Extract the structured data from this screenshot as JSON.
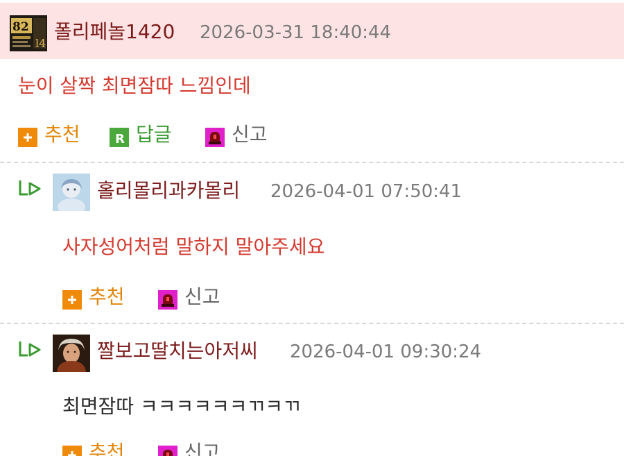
{
  "comments": [
    {
      "nickname": "폴리페놀1420",
      "date": "2026-03-31 18:40:44",
      "text": "눈이 살짝 최면잠따 느낌인데",
      "actions": {
        "recommend": "추천",
        "reply": "답글",
        "report": "신고"
      }
    },
    {
      "nickname": "홀리몰리과카몰리",
      "date": "2026-04-01 07:50:41",
      "text": "사자성어처럼 말하지 말아주세요",
      "actions": {
        "recommend": "추천",
        "report": "신고"
      }
    },
    {
      "nickname": "짤보고딸치는아저씨",
      "date": "2026-04-01 09:30:24",
      "text": "최면잠따 ㅋㅋㅋㅋㅋㅋㄲㅋㄲ",
      "actions": {
        "recommend": "추천",
        "report": "신고"
      }
    }
  ],
  "icons": {
    "recommend": "plus-icon",
    "reply": "reply-r-icon",
    "report": "siren-icon",
    "nested": "nested-reply-arrow-icon"
  },
  "colors": {
    "highlight_row": "#fde3e3",
    "nickname": "#7b1a1a",
    "date": "#7a7a7a",
    "emphasis_text": "#d43a2f",
    "recommend": "#e2860a",
    "reply": "#3b9a32",
    "report": "#e020c8"
  }
}
